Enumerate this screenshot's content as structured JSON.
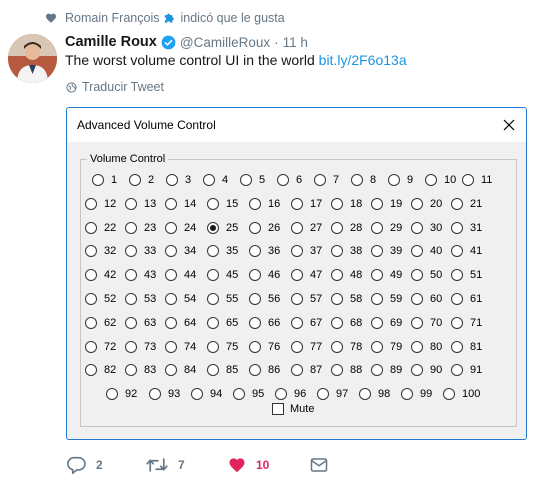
{
  "liked_by": {
    "user": "Romain François",
    "text": "indicó que le gusta"
  },
  "tweet": {
    "author_name": "Camille Roux",
    "handle": "@CamilleRoux",
    "separator": "·",
    "time": "11 h",
    "text": "The worst volume control UI in the world",
    "link": "bit.ly/2F6o13a",
    "translate": "Traducir Tweet"
  },
  "dialog": {
    "title": "Advanced Volume Control",
    "group_label": "Volume Control",
    "selected_value": "25",
    "options": [
      "1",
      "2",
      "3",
      "4",
      "5",
      "6",
      "7",
      "8",
      "9",
      "10",
      "11",
      "12",
      "13",
      "14",
      "15",
      "16",
      "17",
      "18",
      "19",
      "20",
      "21",
      "22",
      "23",
      "24",
      "25",
      "26",
      "27",
      "28",
      "29",
      "30",
      "31",
      "32",
      "33",
      "34",
      "35",
      "36",
      "37",
      "38",
      "39",
      "40",
      "41",
      "42",
      "43",
      "44",
      "45",
      "46",
      "47",
      "48",
      "49",
      "50",
      "51",
      "52",
      "53",
      "54",
      "55",
      "56",
      "57",
      "58",
      "59",
      "60",
      "61",
      "62",
      "63",
      "64",
      "65",
      "66",
      "67",
      "68",
      "69",
      "70",
      "71",
      "72",
      "73",
      "74",
      "75",
      "76",
      "77",
      "78",
      "79",
      "80",
      "81",
      "82",
      "83",
      "84",
      "85",
      "86",
      "87",
      "88",
      "89",
      "90",
      "91",
      "92",
      "93",
      "94",
      "95",
      "96",
      "97",
      "98",
      "99",
      "100"
    ],
    "mute_label": "Mute",
    "mute_checked": false
  },
  "actions": {
    "replies": "2",
    "retweets": "7",
    "likes": "10"
  },
  "colors": {
    "accent": "#1b95e0",
    "like": "#e0245e",
    "muted_text": "#657786",
    "window_border": "#1f7bd1"
  }
}
